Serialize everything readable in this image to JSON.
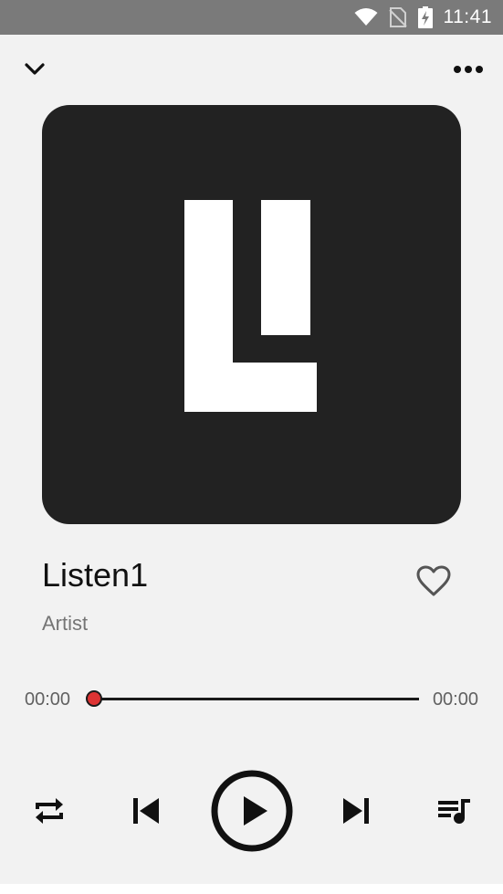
{
  "status_bar": {
    "time": "11:41",
    "icons": [
      "wifi-icon",
      "no-sim-icon",
      "battery-charging-icon"
    ]
  },
  "top_bar": {
    "collapse_icon": "chevron-down-icon",
    "more_icon": "more-horizontal-icon"
  },
  "album_art": {
    "background": "#222222",
    "logo_color": "#ffffff"
  },
  "track": {
    "title": "Listen1",
    "artist": "Artist",
    "favorite_icon": "heart-outline-icon",
    "favorited": false
  },
  "progress": {
    "current": "00:00",
    "total": "00:00",
    "fraction": 0.0,
    "accent": "#dd3333"
  },
  "controls": {
    "repeat_icon": "repeat-icon",
    "previous_icon": "skip-previous-icon",
    "play_icon": "play-circle-icon",
    "next_icon": "skip-next-icon",
    "playlist_icon": "queue-music-icon"
  }
}
